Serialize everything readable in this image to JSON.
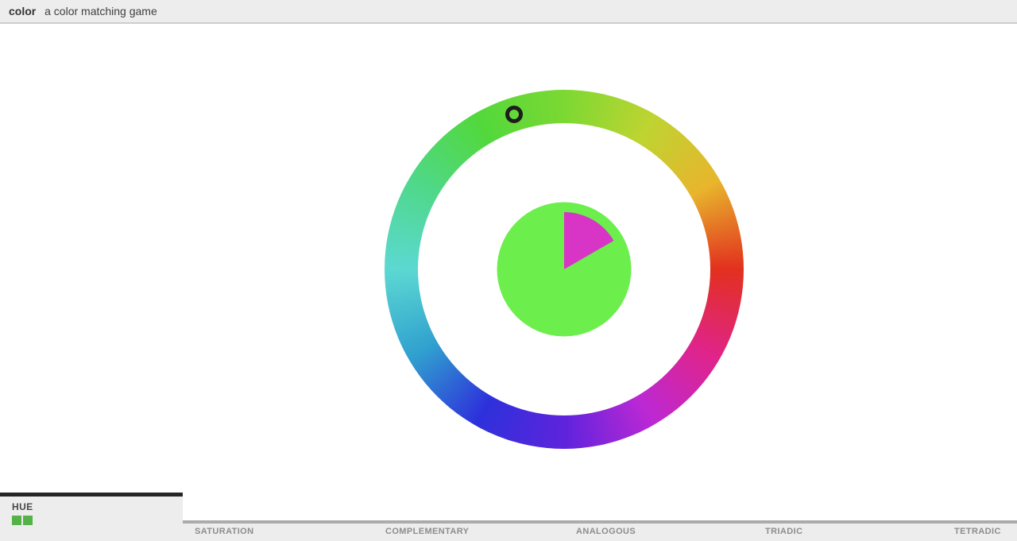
{
  "header": {
    "app_name": "color",
    "tagline": "a color matching game"
  },
  "colors": {
    "header_bg": "#ededed",
    "target_circle": "#6cee4d",
    "timer_wedge": "#d835c6",
    "marker_ring": "#1d1d1d",
    "progress_square": "#55b249",
    "active_tab_bar": "#262626",
    "inactive_tab_bar": "#ababab",
    "tab_label_inactive": "#8d8d8d",
    "tab_label_active": "#474747"
  },
  "wheel": {
    "description": "hue ring, red at right, hue increases counter-clockwise",
    "stop_interval_deg": 30,
    "gradient_stops": [
      "#7cd832",
      "#bed431",
      "#e8b52c",
      "#e2301e",
      "#e02489",
      "#bc28d4",
      "#5e23dd",
      "#2d31db",
      "#30a0cf",
      "#5cd8d2",
      "#4fd88a",
      "#52d83c",
      "#7cd832"
    ],
    "marker": {
      "angle_deg": 108,
      "radius": 205
    }
  },
  "timer_wedge": {
    "start_deg": 90,
    "sweep_deg": 60,
    "radius": 72
  },
  "tabs": [
    {
      "label": "HUE",
      "active": true,
      "completed_levels": 2
    },
    {
      "label": "SATURATION",
      "active": false
    },
    {
      "label": "COMPLEMENTARY",
      "active": false
    },
    {
      "label": "ANALOGOUS",
      "active": false
    },
    {
      "label": "TRIADIC",
      "active": false
    },
    {
      "label": "TETRADIC",
      "active": false
    }
  ]
}
